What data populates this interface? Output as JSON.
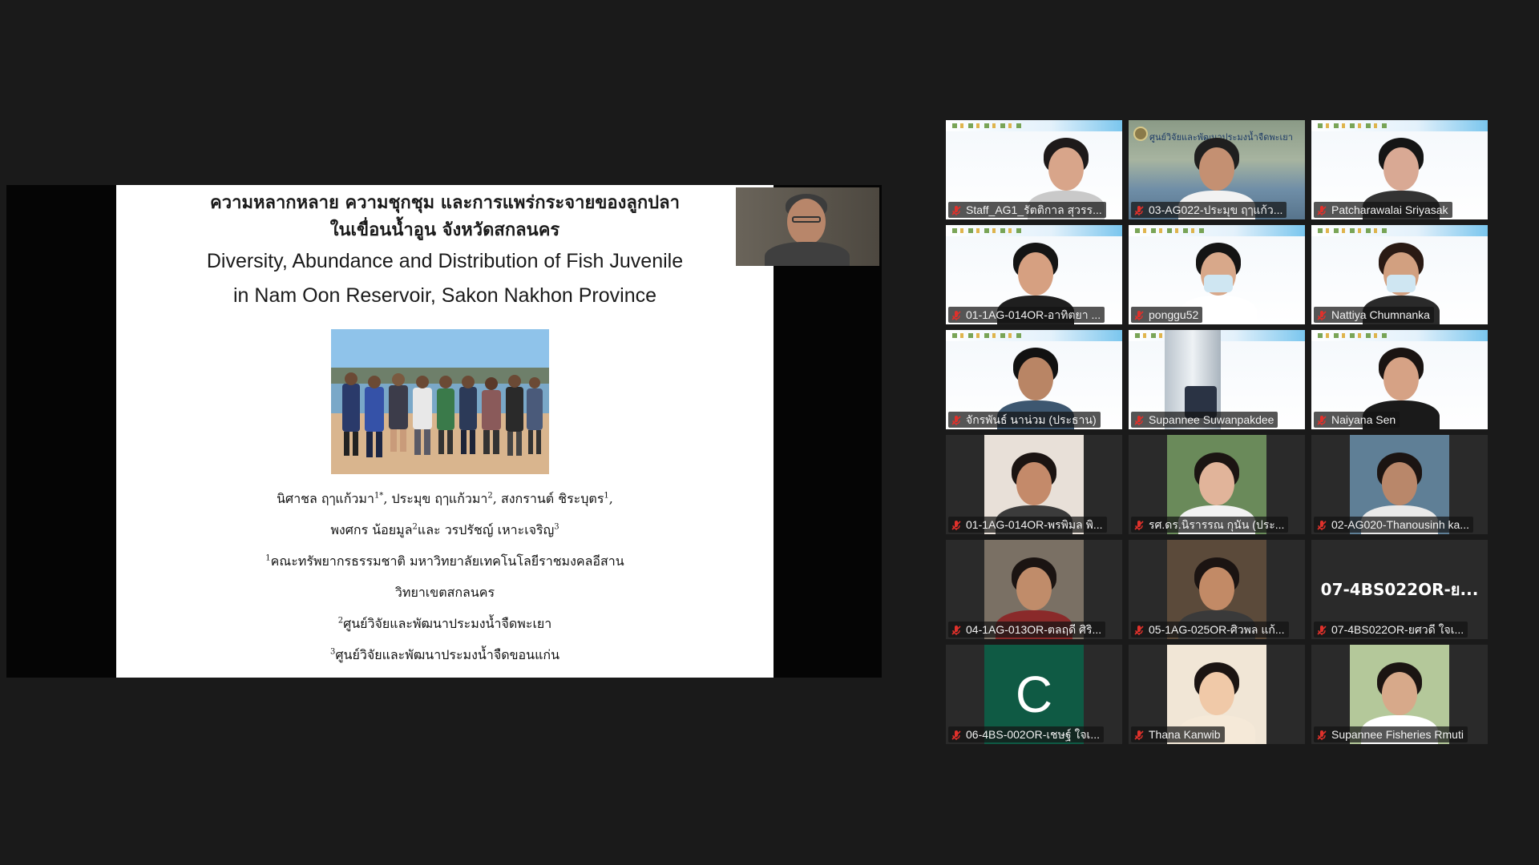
{
  "slide": {
    "title_th_1": "ความหลากหลาย ความชุกชุม และการแพร่กระจายของลูกปลา",
    "title_th_2": "ในเขื่อนน้ำอูน จังหวัดสกลนคร",
    "title_en_1": "Diversity, Abundance and Distribution of Fish Juvenile",
    "title_en_2": "in Nam Oon Reservoir, Sakon Nakhon Province",
    "authors_1": "นิศาชล  ฤๅแก้วมา",
    "authors_1_sup": "1*",
    "authors_1b": ", ประมุข  ฤๅแก้วมา",
    "authors_1b_sup": "2",
    "authors_1c": ", สงกรานต์  ชิระบุตร",
    "authors_1c_sup": "1",
    "authors_1d": ",",
    "authors_2a": "พงศกร น้อยมูล",
    "authors_2a_sup": "2",
    "authors_2b": "และ วรปรัชญ์ เหาะเจริญ",
    "authors_2b_sup": "3",
    "affil_1_sup": "1",
    "affil_1": "คณะทรัพยากรธรรมชาติ มหาวิทยาลัยเทคโนโลยีราชมงคลอีสาน",
    "affil_1b": "วิทยาเขตสกลนคร",
    "affil_2_sup": "2",
    "affil_2": "ศูนย์วิจัยและพัฒนาประมงน้ำจืดพะเยา",
    "affil_3_sup": "3",
    "affil_3": "ศูนย์วิจัยและพัฒนาประมงน้ำจืดขอนแก่น"
  },
  "participants": [
    {
      "name": "Staff_AG1_รัตติกาล สุวรร...",
      "muted": true
    },
    {
      "name": "03-AG022-ประมุข ฤๅแก้ว...",
      "muted": true,
      "active_speaker": true,
      "banner": "ศูนย์วิจัยและพัฒนาประมงน้ำจืดพะเยา"
    },
    {
      "name": "Patcharawalai Sriyasak",
      "muted": true
    },
    {
      "name": "01-1AG-014OR-อาทิตยา ...",
      "muted": true
    },
    {
      "name": "ponggu52",
      "muted": true
    },
    {
      "name": "Nattiya Chumnanka",
      "muted": true
    },
    {
      "name": "จักรพันธ์ นาน่วม (ประธาน)",
      "muted": true
    },
    {
      "name": "Supannee Suwanpakdee",
      "muted": true
    },
    {
      "name": "Naiyana Sen",
      "muted": true
    },
    {
      "name": "01-1AG-014OR-พรพิมล พิ...",
      "muted": true
    },
    {
      "name": "รศ.ดร.นิรารรณ กุนัน (ประ...",
      "muted": true
    },
    {
      "name": "02-AG020-Thanousinh ka...",
      "muted": true
    },
    {
      "name": "04-1AG-013OR-ตลฤดี ศิริ...",
      "muted": true
    },
    {
      "name": "05-1AG-025OR-ศิวพล แก้...",
      "muted": true
    },
    {
      "name": "07-4BS022OR-ยศวดี ใจเ...",
      "muted": true,
      "video_off_label": "07-4BS022OR-ย..."
    },
    {
      "name": "06-4BS-002OR-เชษฐ์ ใจเ...",
      "muted": true,
      "initial": "C"
    },
    {
      "name": "Thana Kanwib",
      "muted": true
    },
    {
      "name": "Supannee Fisheries Rmuti",
      "muted": true
    }
  ],
  "colors": {
    "background": "#1a1a1a",
    "active_border": "#b6e23a",
    "muted_icon": "#e0312b",
    "initial_tile": "#0f5a44"
  }
}
